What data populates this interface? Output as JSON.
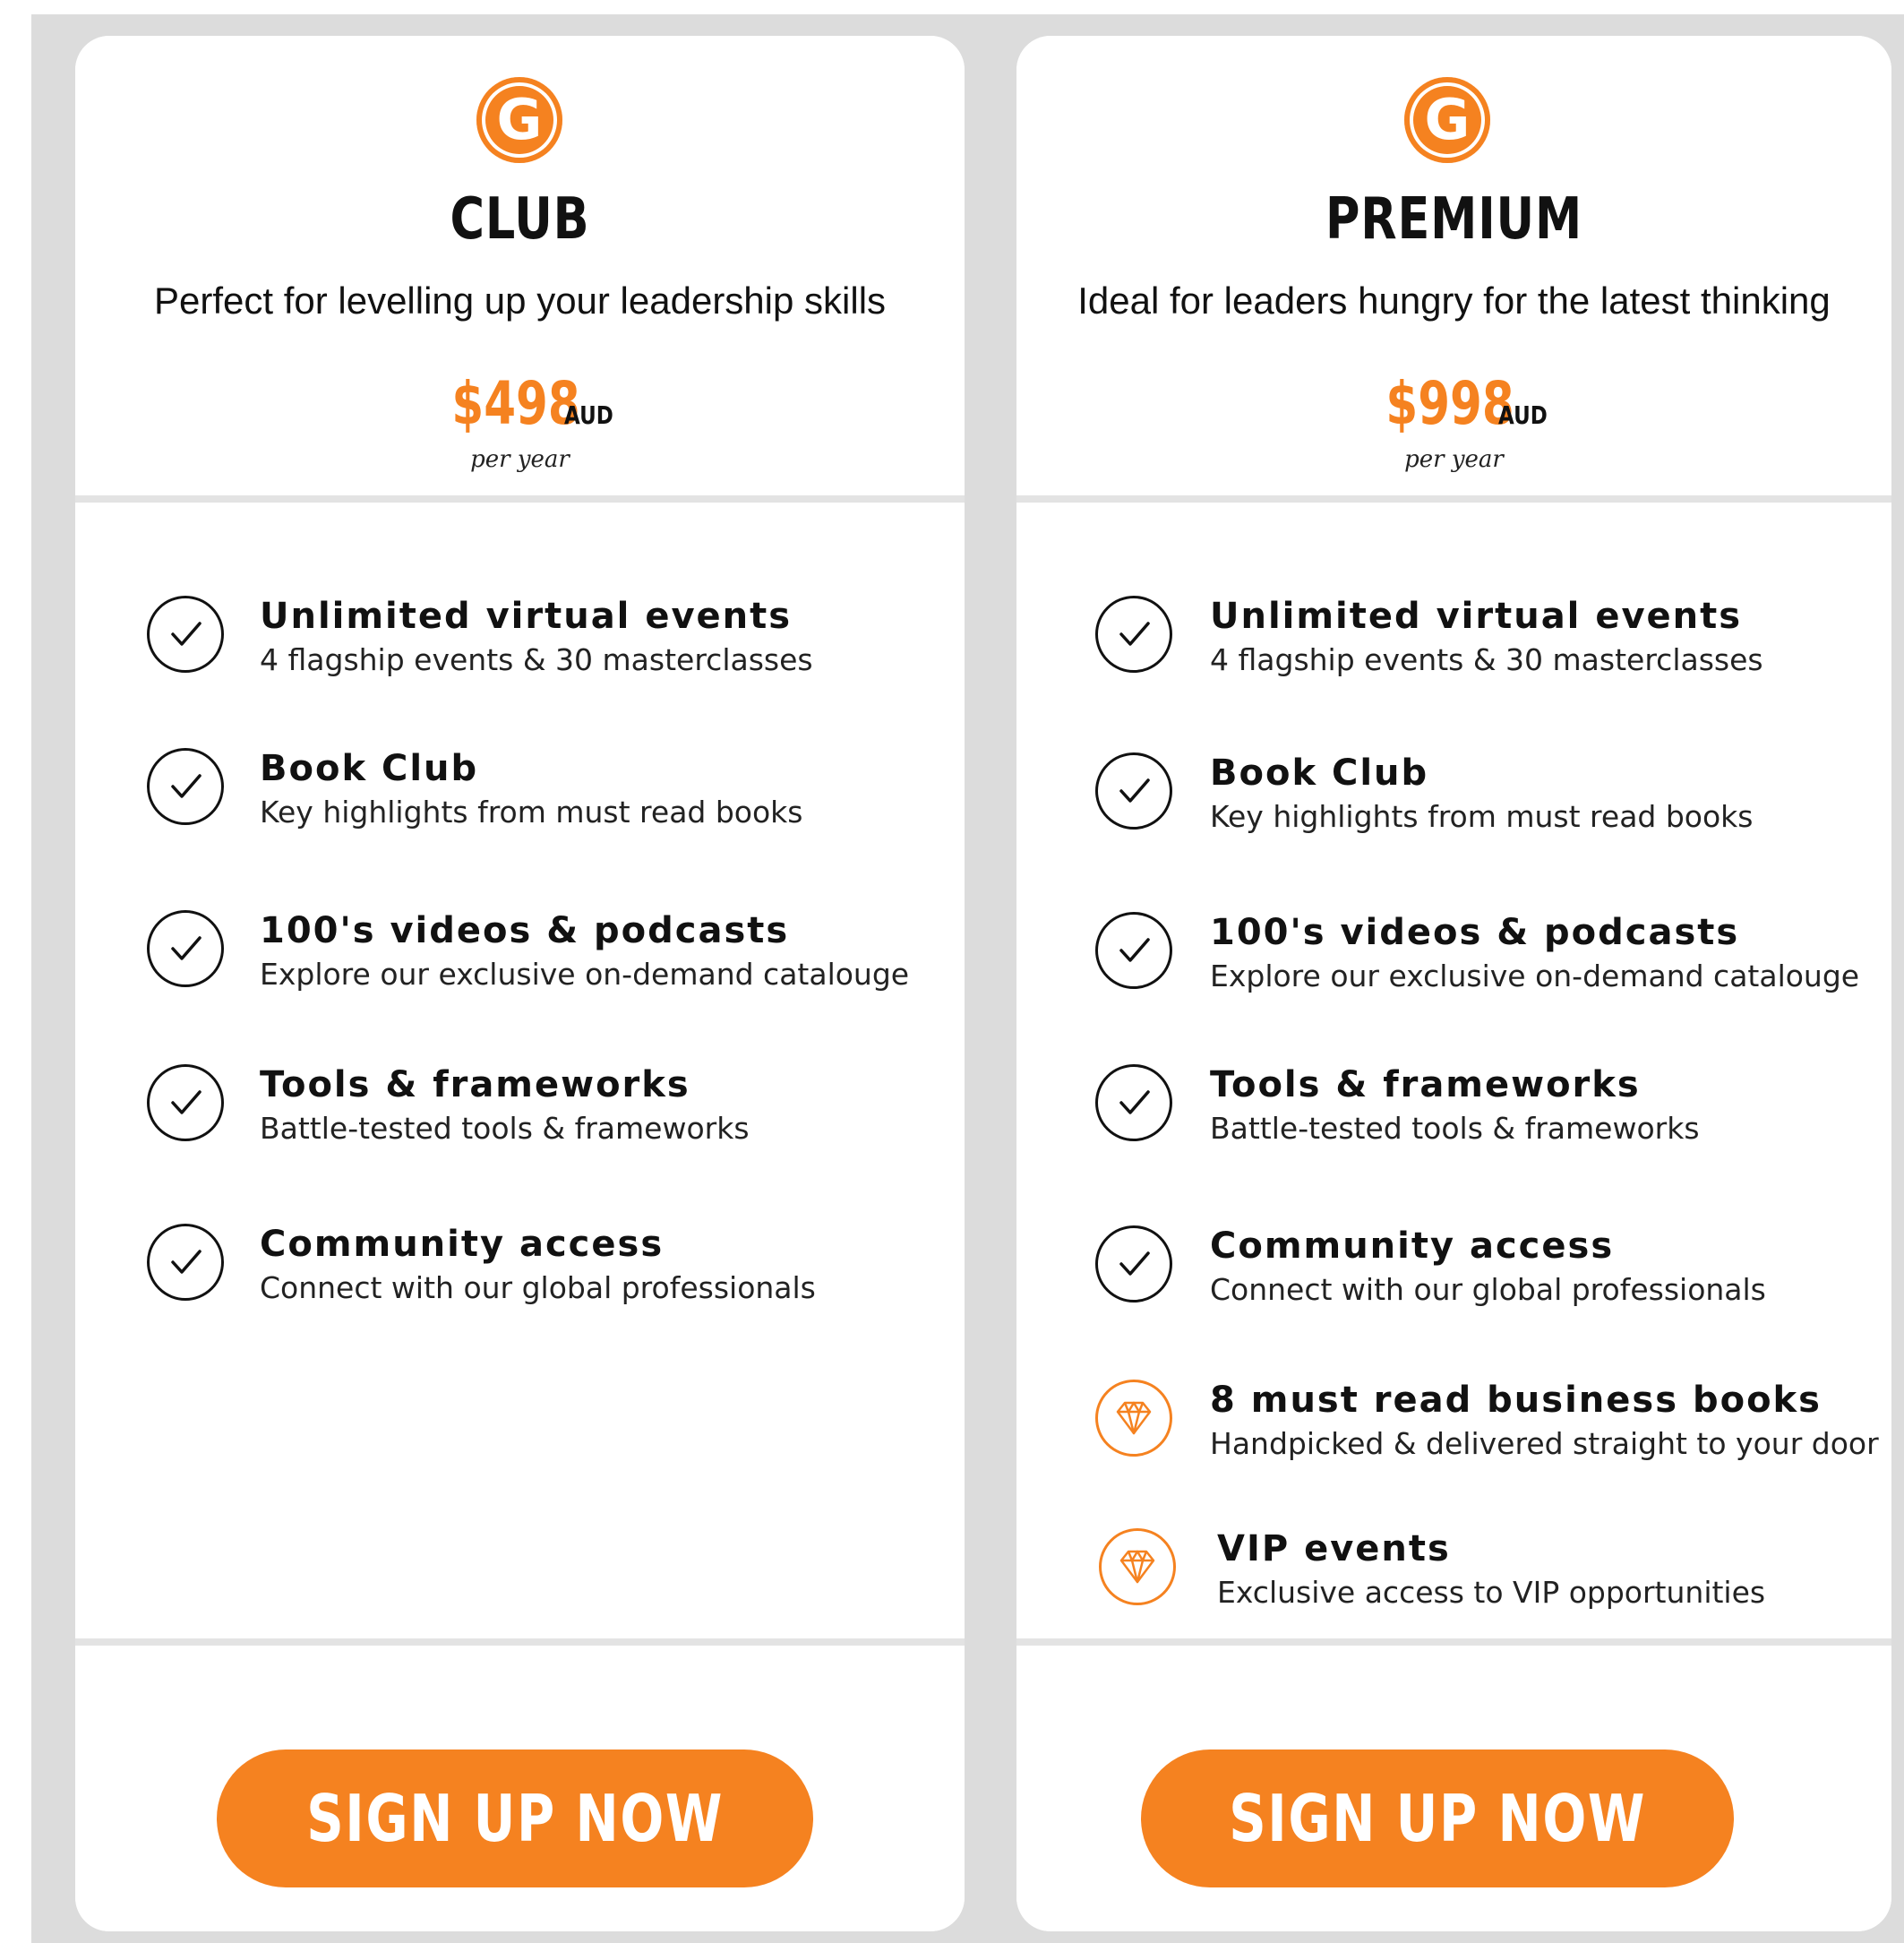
{
  "plans": [
    {
      "logo_letter": "G",
      "name": "CLUB",
      "tagline": "Perfect for levelling up your leadership skills",
      "price": "$498",
      "currency": "AUD",
      "period": "per year",
      "features": [
        {
          "icon": "check-circle-icon",
          "title": "Unlimited virtual events",
          "desc": "4 flagship events & 30 masterclasses"
        },
        {
          "icon": "check-circle-icon",
          "title": "Book Club",
          "desc": "Key highlights from must read books"
        },
        {
          "icon": "check-circle-icon",
          "title": "100's videos & podcasts",
          "desc": "Explore our exclusive on-demand catalouge"
        },
        {
          "icon": "check-circle-icon",
          "title": "Tools & frameworks",
          "desc": "Battle-tested tools & frameworks"
        },
        {
          "icon": "check-circle-icon",
          "title": "Community access",
          "desc": "Connect with our global professionals"
        }
      ],
      "cta": "SIGN UP NOW"
    },
    {
      "logo_letter": "G",
      "name": "PREMIUM",
      "tagline": "Ideal for leaders hungry for the latest thinking",
      "price": "$998",
      "currency": "AUD",
      "period": "per year",
      "features": [
        {
          "icon": "check-circle-icon",
          "title": "Unlimited virtual events",
          "desc": "4 flagship events & 30 masterclasses"
        },
        {
          "icon": "check-circle-icon",
          "title": "Book Club",
          "desc": "Key highlights from must read books"
        },
        {
          "icon": "check-circle-icon",
          "title": "100's videos & podcasts",
          "desc": "Explore our exclusive on-demand catalouge"
        },
        {
          "icon": "check-circle-icon",
          "title": "Tools & frameworks",
          "desc": "Battle-tested tools & frameworks"
        },
        {
          "icon": "check-circle-icon",
          "title": "Community access",
          "desc": "Connect with our global professionals"
        },
        {
          "icon": "diamond-icon",
          "title": "8 must read business books",
          "desc": "Handpicked & delivered straight to your door"
        },
        {
          "icon": "diamond-icon",
          "title": "VIP events",
          "desc": "Exclusive access to VIP opportunities"
        }
      ],
      "cta": "SIGN UP NOW"
    }
  ],
  "colors": {
    "accent": "#f58220",
    "background": "#dcdcdc",
    "card": "#ffffff",
    "text": "#111111"
  }
}
